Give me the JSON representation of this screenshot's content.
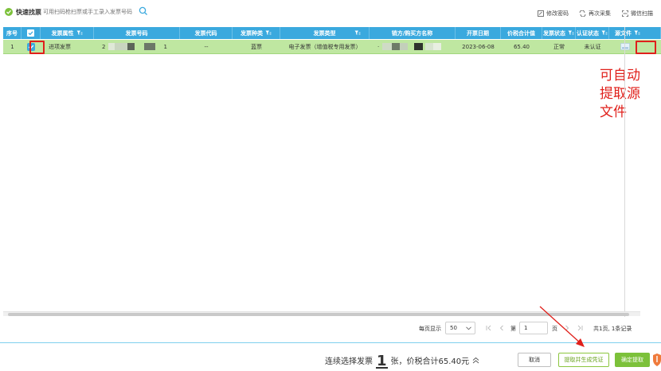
{
  "toolbar": {
    "quick_label": "快速找票",
    "search_placeholder": "可用扫码枪扫票或手工录入发票号码",
    "edit_password": "修改密码",
    "recollect": "再次采集",
    "wechat_scan": "微信扫描"
  },
  "table": {
    "columns": [
      "序号",
      "",
      "发票属性",
      "发票号码",
      "发票代码",
      "发票种类",
      "发票类型",
      "销方/购买方名称",
      "开票日期",
      "价税合计值",
      "发票状态",
      "认证状态",
      "源文件"
    ],
    "rows": [
      {
        "index": "1",
        "checked": true,
        "attribute": "进项发票",
        "number_prefix": "2",
        "number_suffix": "1",
        "code": "--",
        "kind": "蓝票",
        "type": "电子发票（增值税专用发票）",
        "name_prefix": "·",
        "date": "2023-06-08",
        "amount": "65.40",
        "invoice_status": "正常",
        "auth_status": "未认证"
      }
    ]
  },
  "annotation": [
    "可自动",
    "提取源",
    "文件"
  ],
  "pager": {
    "per_page_label": "每页显示",
    "per_page_value": "50",
    "page_label_pre": "第",
    "page_value": "1",
    "page_label_post": "页",
    "summary": "共1页, 1条记录"
  },
  "footer": {
    "prefix": "连续选择发票",
    "count": "1",
    "suffix": "张，价税合计65.40元",
    "cancel": "取消",
    "extract": "提取并生成凭证",
    "confirm": "确定提取"
  },
  "colors": {
    "header_blue": "#3aa9de",
    "row_green": "#bfe7a1",
    "accent_green": "#7cc13a",
    "annotation_red": "#e0201b"
  }
}
